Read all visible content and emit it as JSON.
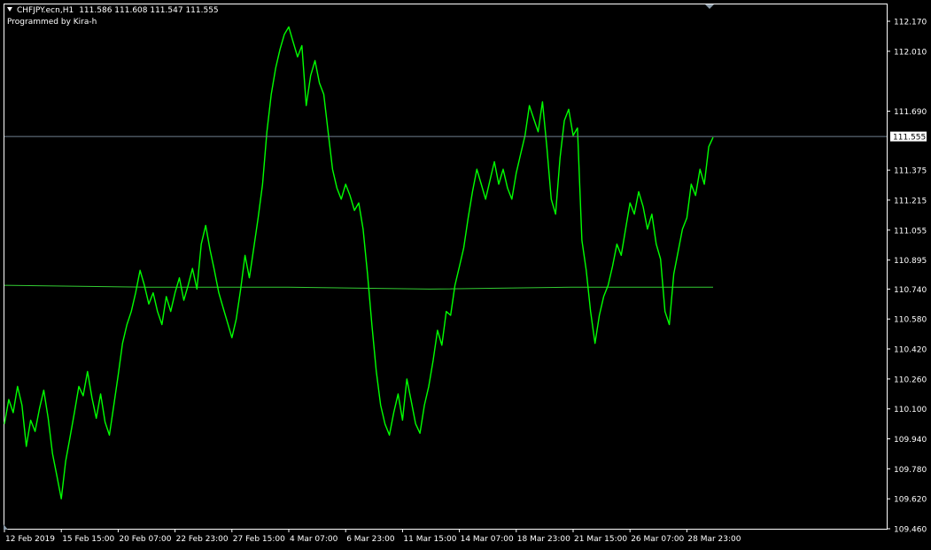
{
  "header": {
    "symbol": "CHFJPY.ecn,H1",
    "ohlc": "111.586 111.608 111.547 111.555",
    "subtitle": "Programmed by Kira-h"
  },
  "colors": {
    "background": "#000000",
    "price_line": "#00ff00",
    "moving_average": "#33cc33",
    "bid_line": "#708090",
    "axis": "#ffffff"
  },
  "chart_data": {
    "type": "line",
    "series": [
      {
        "values": [
          110.02,
          110.15,
          110.08,
          110.22,
          110.12,
          109.9,
          110.04,
          109.98,
          110.1,
          110.2,
          110.05,
          109.86,
          109.74,
          109.62,
          109.82,
          109.95,
          110.08,
          110.22,
          110.17,
          110.3,
          110.16,
          110.05,
          110.18,
          110.03,
          109.96,
          110.12,
          110.28,
          110.45,
          110.55,
          110.62,
          110.72,
          110.84,
          110.76,
          110.66,
          110.72,
          110.62,
          110.55,
          110.7,
          110.62,
          110.72,
          110.8,
          110.68,
          110.76,
          110.85,
          110.74,
          110.98,
          111.08,
          110.95,
          110.84,
          110.72,
          110.64,
          110.56,
          110.48,
          110.58,
          110.74,
          110.92,
          110.8,
          110.96,
          111.12,
          111.3,
          111.58,
          111.78,
          111.92,
          112.02,
          112.1,
          112.14,
          112.06,
          111.98,
          112.04,
          111.72,
          111.88,
          111.96,
          111.84,
          111.78,
          111.58,
          111.38,
          111.28,
          111.22,
          111.3,
          111.24,
          111.16,
          111.2,
          111.06,
          110.82,
          110.55,
          110.3,
          110.12,
          110.02,
          109.96,
          110.08,
          110.18,
          110.04,
          110.26,
          110.14,
          110.02,
          109.97,
          110.12,
          110.22,
          110.36,
          110.52,
          110.44,
          110.62,
          110.6,
          110.76,
          110.86,
          110.96,
          111.12,
          111.26,
          111.38,
          111.3,
          111.22,
          111.32,
          111.42,
          111.3,
          111.38,
          111.28,
          111.22,
          111.36,
          111.46,
          111.56,
          111.72,
          111.65,
          111.58,
          111.74,
          111.5,
          111.22,
          111.14,
          111.44,
          111.64,
          111.7,
          111.56,
          111.6,
          111.0,
          110.84,
          110.62,
          110.45,
          110.6,
          110.7,
          110.76,
          110.86,
          110.98,
          110.92,
          111.06,
          111.2,
          111.14,
          111.26,
          111.18,
          111.06,
          111.14,
          110.98,
          110.9,
          110.62,
          110.55,
          110.82,
          110.94,
          111.06,
          111.12,
          111.3,
          111.24,
          111.38,
          111.3,
          111.5,
          111.55
        ]
      }
    ],
    "moving_average": [
      110.76,
      110.75,
      110.75,
      110.74,
      110.75,
      110.75
    ],
    "current_bid": 111.555,
    "current_bid_label": "111.555",
    "ylim": [
      109.46,
      112.26
    ],
    "y_ticks": [
      "112.170",
      "112.010",
      "111.690",
      "111.375",
      "111.215",
      "111.055",
      "110.895",
      "110.740",
      "110.580",
      "110.420",
      "110.260",
      "110.100",
      "109.940",
      "109.780",
      "109.620",
      "109.460"
    ],
    "y_tick_values": [
      112.17,
      112.01,
      111.69,
      111.375,
      111.215,
      111.055,
      110.895,
      110.74,
      110.58,
      110.42,
      110.26,
      110.1,
      109.94,
      109.78,
      109.62,
      109.46
    ],
    "x_ticks": [
      "12 Feb 2019",
      "15 Feb 15:00",
      "20 Feb 07:00",
      "22 Feb 23:00",
      "27 Feb 15:00",
      "4 Mar 07:00",
      "6 Mar 23:00",
      "11 Mar 15:00",
      "14 Mar 07:00",
      "18 Mar 23:00",
      "21 Mar 15:00",
      "26 Mar 07:00",
      "28 Mar 23:00"
    ],
    "grid": false,
    "legend": "none"
  }
}
